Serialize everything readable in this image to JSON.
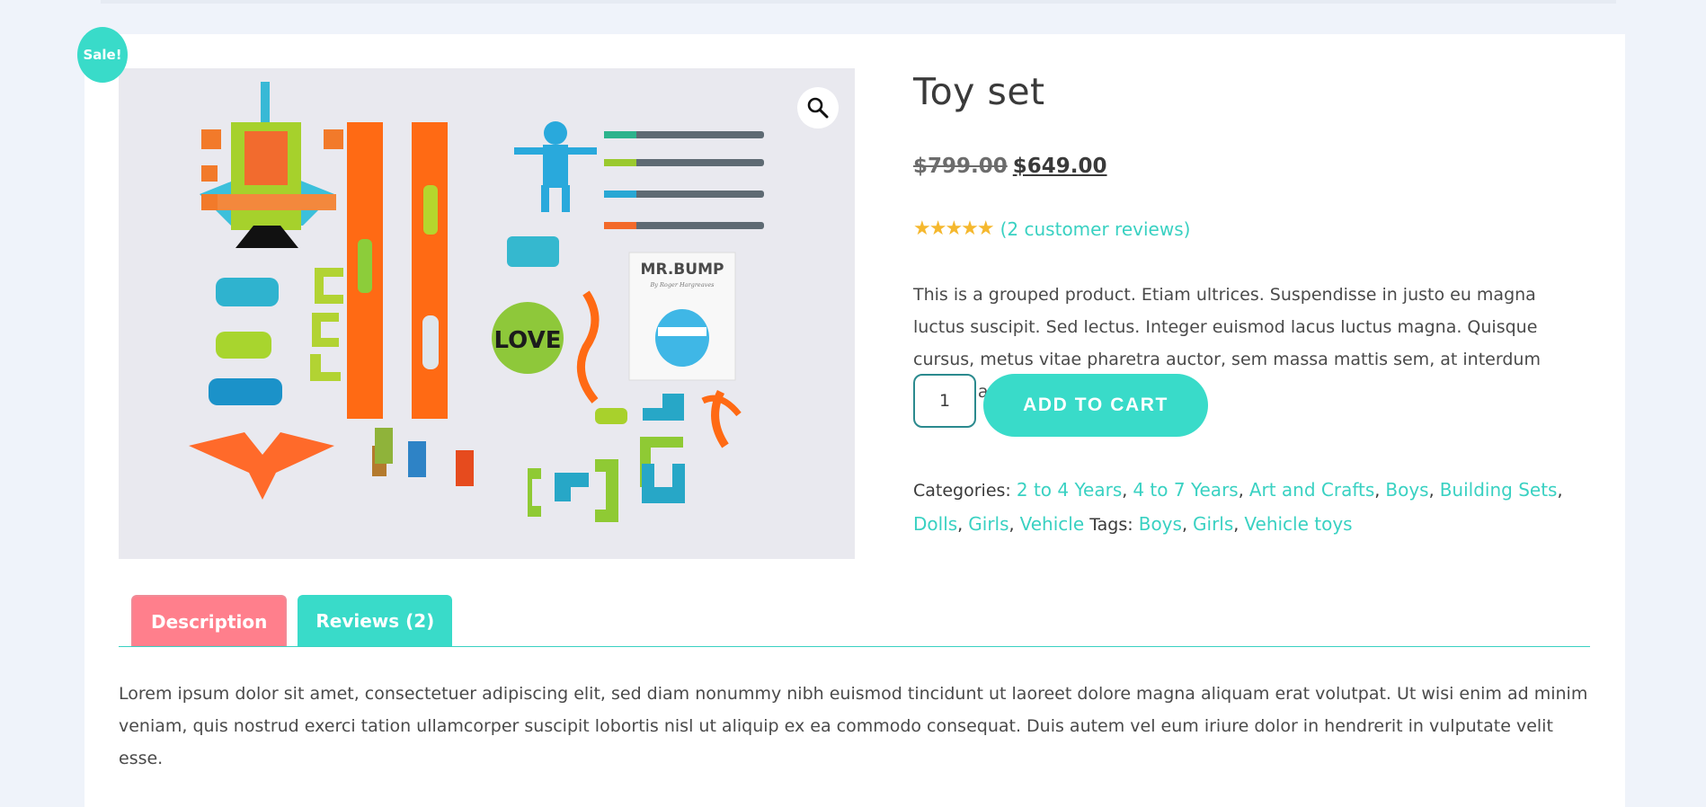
{
  "badge": {
    "sale": "Sale!"
  },
  "product": {
    "title": "Toy set",
    "price_old": "$799.00",
    "price_new": "$649.00",
    "rating": 5,
    "stars": "★★★★★",
    "reviews_link": "(2 customer reviews)",
    "description": "This is a grouped product. Etiam ultrices. Suspendisse in justo eu magna luctus suscipit. Sed lectus. Integer euismod lacus luctus magna. Quisque cursus, metus vitae pharetra auctor, sem massa mattis sem, at interdum magna augue eget diam.",
    "quantity": "1",
    "add_to_cart": "ADD TO CART"
  },
  "gallery": {
    "zoom_icon": "magnifier-icon",
    "image_text_book_title": "MR.BUMP",
    "image_text_book_author": "By Roger Hargreaves",
    "image_text_badge": "LOVE"
  },
  "meta": {
    "categories_label": "Categories:",
    "categories": [
      "2 to 4 Years",
      "4 to 7 Years",
      "Art and Crafts",
      "Boys",
      "Building Sets",
      "Dolls",
      "Girls",
      "Vehicle"
    ],
    "tags_label": "Tags:",
    "tags": [
      "Boys",
      "Girls",
      "Vehicle toys"
    ]
  },
  "tabs": {
    "description": "Description",
    "reviews": "Reviews (2)",
    "content": "Lorem ipsum dolor sit amet, consectetuer adipiscing elit, sed diam nonummy nibh euismod tincidunt ut laoreet dolore magna aliquam erat volutpat. Ut wisi enim ad minim veniam, quis nostrud exerci tation ullamcorper suscipit lobortis nisl ut aliquip ex ea commodo consequat. Duis autem vel eum iriure dolor in hendrerit in vulputate velit esse."
  },
  "colors": {
    "accent": "#39dbc9",
    "description_tab": "#ff7f8c",
    "star": "#f5b82e",
    "background": "#eff3fa"
  }
}
